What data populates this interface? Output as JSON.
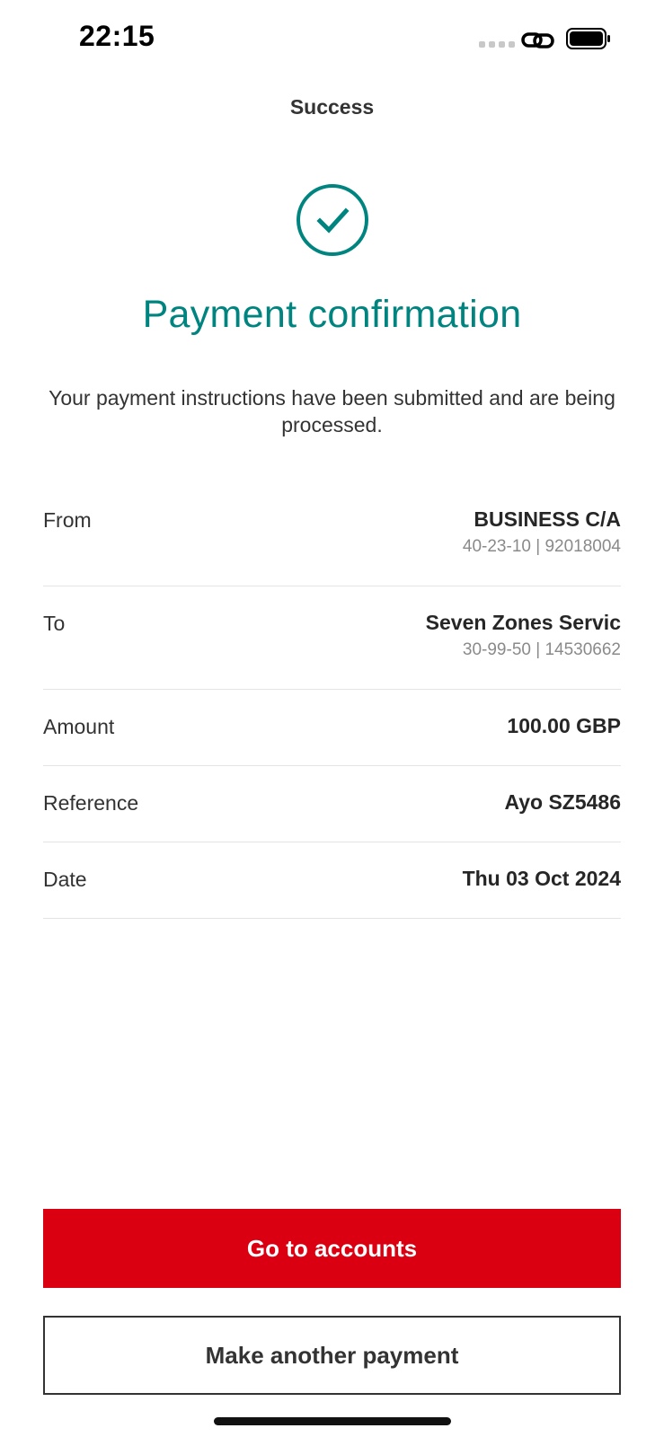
{
  "status_bar": {
    "time": "22:15"
  },
  "header": {
    "title": "Success"
  },
  "confirmation": {
    "icon": "check-circle-icon",
    "title": "Payment confirmation",
    "message": "Your payment instructions have been submitted and are being processed."
  },
  "details": [
    {
      "label": "From",
      "value": "BUSINESS C/A",
      "sub": "40-23-10 | 92018004"
    },
    {
      "label": "To",
      "value": "Seven Zones Servic",
      "sub": "30-99-50 | 14530662"
    },
    {
      "label": "Amount",
      "value": "100.00 GBP"
    },
    {
      "label": "Reference",
      "value": "Ayo SZ5486"
    },
    {
      "label": "Date",
      "value": "Thu 03 Oct 2024"
    }
  ],
  "actions": {
    "primary_label": "Go to accounts",
    "secondary_label": "Make another payment"
  },
  "colors": {
    "accent": "#00847f",
    "primary_button": "#db0011",
    "text": "#333333",
    "muted": "#8a8a8a"
  }
}
